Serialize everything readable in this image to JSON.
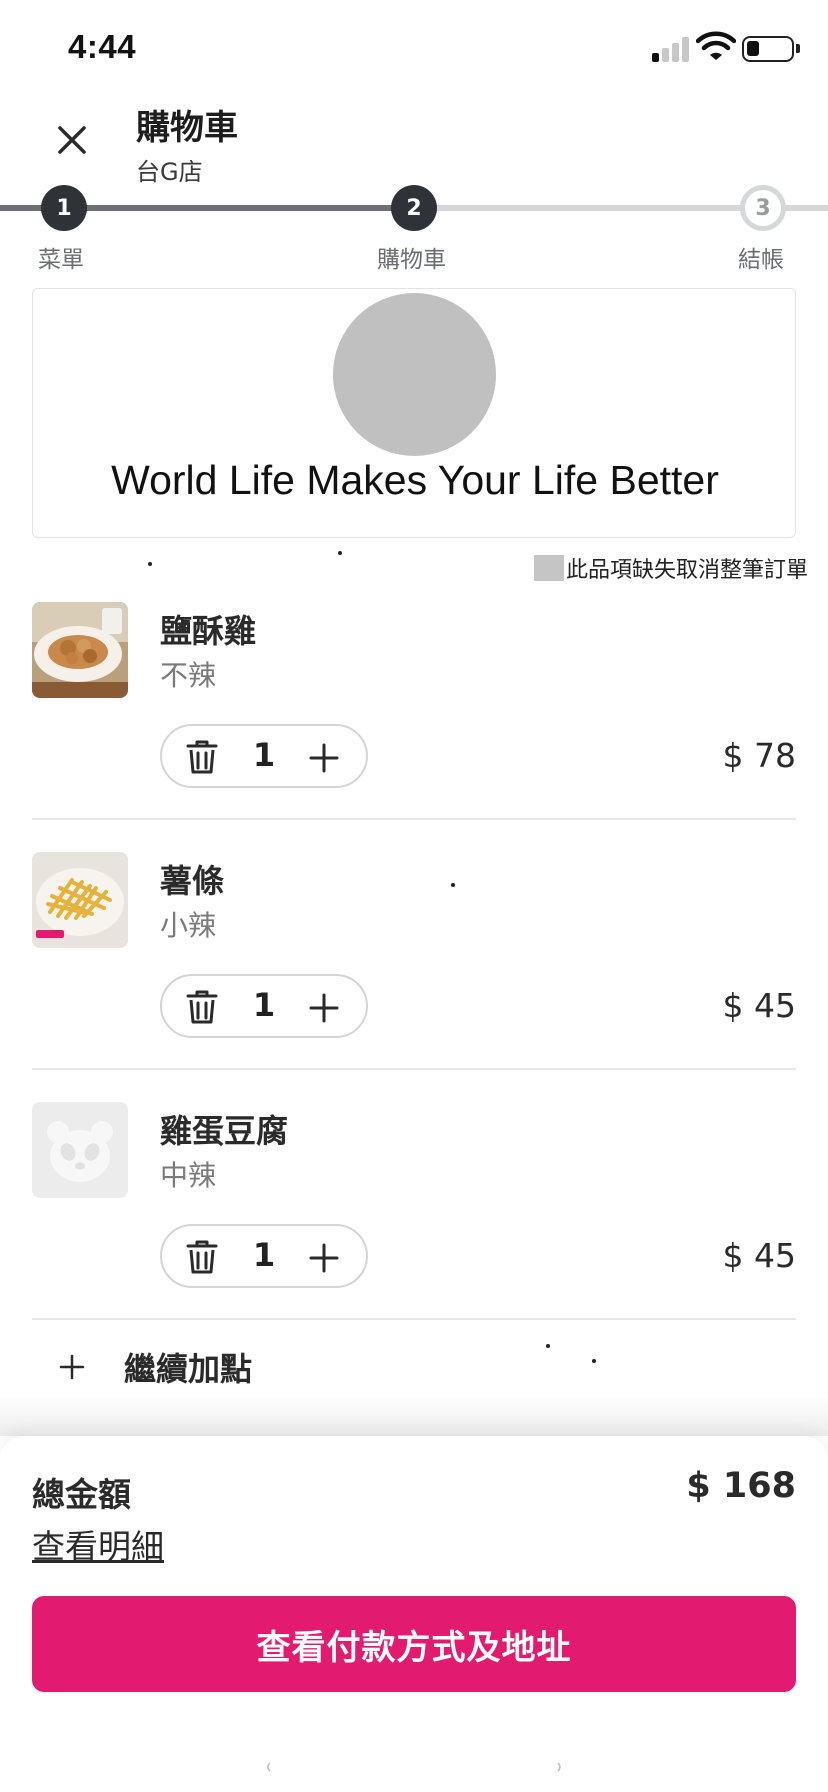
{
  "status_bar": {
    "time": "4:44"
  },
  "header": {
    "title": "購物車",
    "store": "台G店"
  },
  "steps": [
    {
      "number": "1",
      "label": "菜單"
    },
    {
      "number": "2",
      "label": "購物車"
    },
    {
      "number": "3",
      "label": "結帳"
    }
  ],
  "banner": {
    "text": "World Life Makes Your Life Better"
  },
  "notice": {
    "text": "此品項缺失取消整筆訂單"
  },
  "items": [
    {
      "name": "鹽酥雞",
      "option": "不辣",
      "quantity": "1",
      "price": "$ 78"
    },
    {
      "name": "薯條",
      "option": "小辣",
      "quantity": "1",
      "price": "$ 45"
    },
    {
      "name": "雞蛋豆腐",
      "option": "中辣",
      "quantity": "1",
      "price": "$ 45"
    }
  ],
  "add_more": {
    "label": "繼續加點"
  },
  "summary": {
    "total_label": "總金額",
    "total_value": "$ 168",
    "details_link": "查看明細",
    "checkout_button": "查看付款方式及地址"
  },
  "colors": {
    "brand": "#e21b70",
    "step_active": "#2f3238",
    "step_inactive": "#d6d7d9"
  }
}
